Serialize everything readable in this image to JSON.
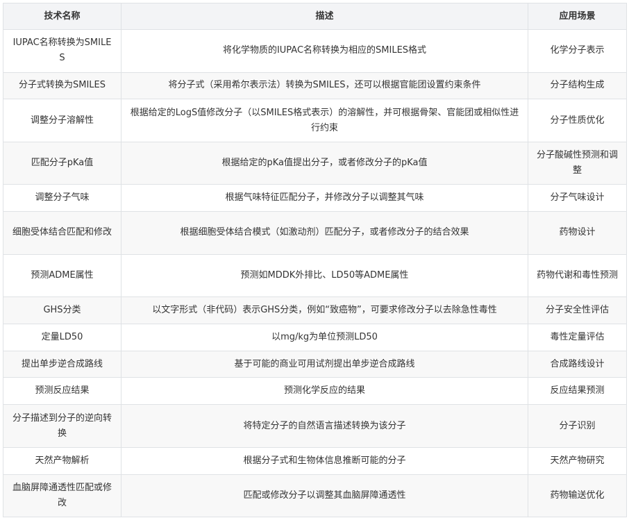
{
  "headers": [
    "技术名称",
    "描述",
    "应用场景"
  ],
  "rows": [
    [
      "IUPAC名称转换为SMILES",
      "将化学物质的IUPAC名称转换为相应的SMILES格式",
      "化学分子表示"
    ],
    [
      "分子式转换为SMILES",
      "将分子式（采用希尔表示法）转换为SMILES，还可以根据官能团设置约束条件",
      "分子结构生成"
    ],
    [
      "调整分子溶解性",
      "根据给定的LogS值修改分子（以SMILES格式表示）的溶解性，并可根据骨架、官能团或相似性进行约束",
      "分子性质优化"
    ],
    [
      "匹配分子pKa值",
      "根据给定的pKa值提出分子，或者修改分子的pKa值",
      "分子酸碱性预测和调整"
    ],
    [
      "调整分子气味",
      "根据气味特征匹配分子，并修改分子以调整其气味",
      "分子气味设计"
    ],
    [
      "细胞受体结合匹配和修改",
      "根据细胞受体结合模式（如激动剂）匹配分子，或者修改分子的结合效果",
      "药物设计"
    ],
    [
      "预测ADME属性",
      "预测如MDDK外排比、LD50等ADME属性",
      "药物代谢和毒性预测"
    ],
    [
      "GHS分类",
      "以文字形式（非代码）表示GHS分类，例如“致癌物”，可要求修改分子以去除急性毒性",
      "分子安全性评估"
    ],
    [
      "定量LD50",
      "以mg/kg为单位预测LD50",
      "毒性定量评估"
    ],
    [
      "提出单步逆合成路线",
      "基于可能的商业可用试剂提出单步逆合成路线",
      "合成路线设计"
    ],
    [
      "预测反应结果",
      "预测化学反应的结果",
      "反应结果预测"
    ],
    [
      "分子描述到分子的逆向转换",
      "将特定分子的自然语言描述转换为该分子",
      "分子识别"
    ],
    [
      "天然产物解析",
      "根据分子式和生物体信息推断可能的分子",
      "天然产物研究"
    ],
    [
      "血脑屏障通透性匹配或修改",
      "匹配或修改分子以调整其血脑屏障通透性",
      "药物输送优化"
    ]
  ]
}
